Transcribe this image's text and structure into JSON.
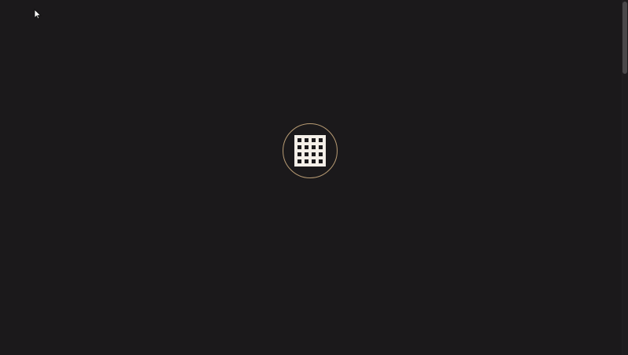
{
  "page": {
    "background": "#1b191b",
    "accent": "#b99c74"
  },
  "loader": {
    "icon": "grid-icon",
    "ring_color": "#b99c74",
    "icon_color": "#f4efe8"
  },
  "cursor": {
    "icon": "arrow-cursor-icon"
  },
  "scrollbar": {
    "thumb_color": "#4a484a"
  }
}
